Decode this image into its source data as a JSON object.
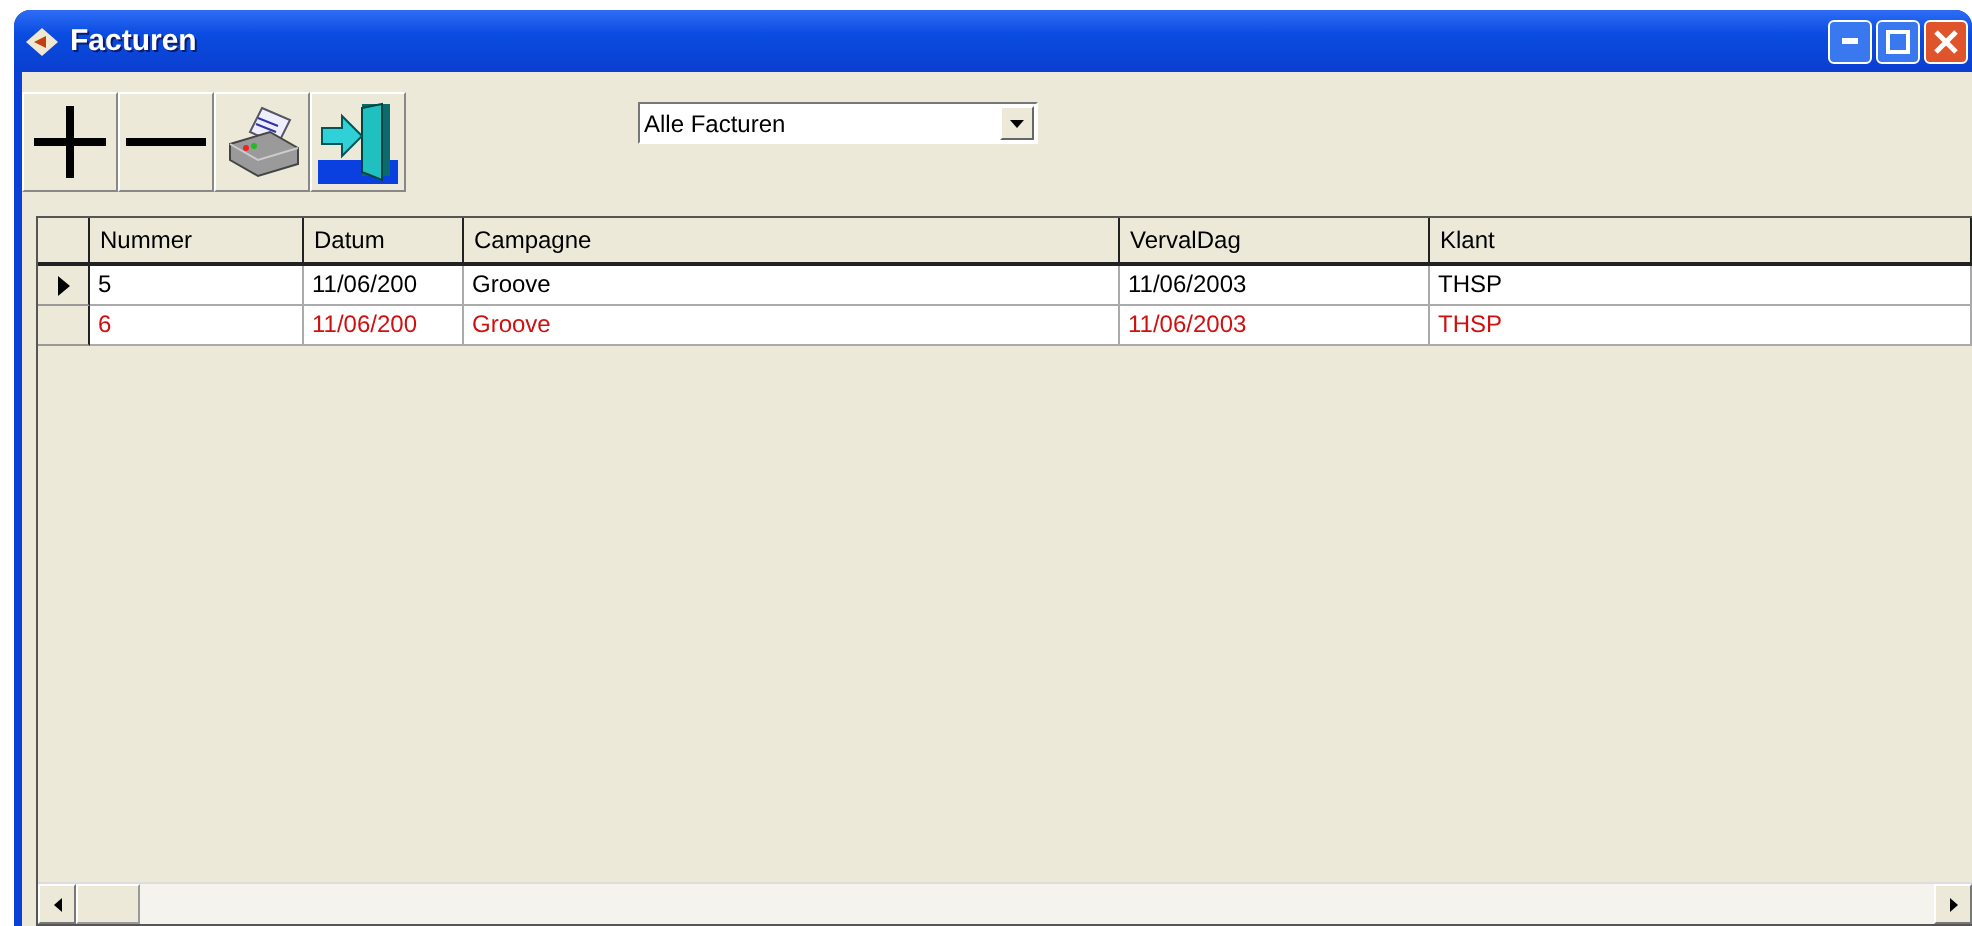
{
  "window": {
    "title": "Facturen"
  },
  "toolbar": {
    "buttons": [
      {
        "kind": "add"
      },
      {
        "kind": "remove"
      },
      {
        "kind": "print"
      },
      {
        "kind": "exit"
      }
    ]
  },
  "filter": {
    "value": "Alle Facturen"
  },
  "table": {
    "columns": [
      "Nummer",
      "Datum",
      "Campagne",
      "VervalDag",
      "Klant"
    ],
    "rows": [
      {
        "selected": true,
        "color": "#000000",
        "cells": [
          "5",
          "11/06/200",
          "Groove",
          "11/06/2003",
          "THSP"
        ]
      },
      {
        "selected": false,
        "color": "#d01010",
        "cells": [
          "6",
          "11/06/200",
          "Groove",
          "11/06/2003",
          "THSP"
        ]
      }
    ]
  }
}
